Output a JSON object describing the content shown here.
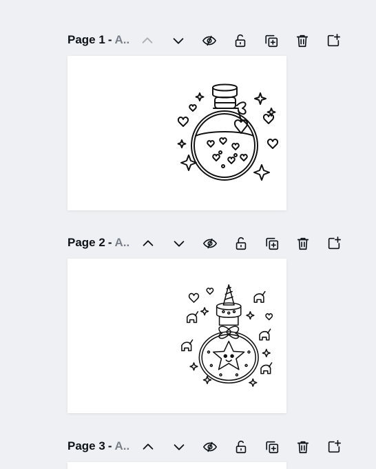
{
  "pages": [
    {
      "label": "Page 1",
      "separator": "-",
      "name": "A..",
      "up_disabled": true,
      "image_icon": "potion-bottle-hearts-illustration"
    },
    {
      "label": "Page 2",
      "separator": "-",
      "name": "A..",
      "up_disabled": false,
      "image_icon": "potion-bottle-unicorn-star-illustration"
    },
    {
      "label": "Page 3",
      "separator": "-",
      "name": "A..",
      "up_disabled": false,
      "image_icon": ""
    }
  ],
  "toolbar_icons": [
    "chevron-up-icon",
    "chevron-down-icon",
    "hide-eye-icon",
    "unlock-icon",
    "duplicate-icon",
    "trash-icon",
    "add-page-icon"
  ],
  "colors": {
    "background": "#eef0f3",
    "text": "#0e1318",
    "muted_text": "#7a8089",
    "icon": "#0e1318"
  }
}
